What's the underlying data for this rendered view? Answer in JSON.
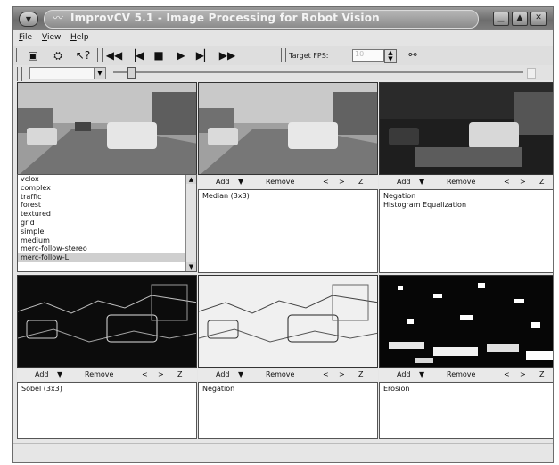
{
  "window": {
    "title": "ImprovCV 5.1 - Image Processing for Robot Vision",
    "sysmenu_icon": "chevron-down-icon",
    "app_icon": "wave-icon",
    "controls": [
      "minimize-icon",
      "maximize-icon",
      "close-icon"
    ]
  },
  "menubar": {
    "items": [
      {
        "label": "File",
        "accel": "F",
        "rest": "ile"
      },
      {
        "label": "View",
        "accel": "V",
        "rest": "iew"
      },
      {
        "label": "Help",
        "accel": "H",
        "rest": "elp"
      }
    ]
  },
  "toolbar": {
    "icons": [
      "camera-icon",
      "settings-icon",
      "help-pointer-icon",
      "skip-back-icon",
      "step-back-icon",
      "stop-icon",
      "play-icon",
      "step-forward-icon",
      "fast-forward-icon"
    ],
    "fps_label": "Target FPS:",
    "fps_value": "10",
    "link_icon": "link-icon"
  },
  "source_list": {
    "items": [
      "vclox",
      "complex",
      "traffic",
      "forest",
      "textured",
      "grid",
      "simple",
      "medium",
      "merc-follow-stereo",
      "merc-follow-L"
    ],
    "selected": "merc-follow-L"
  },
  "controls_row": {
    "add": "Add",
    "dropdown_icon": "triangle-down-icon",
    "remove": "Remove",
    "prev": "<",
    "next": ">",
    "zoom": "Z"
  },
  "panels": [
    {
      "id": "p2",
      "filters": [
        "Median (3x3)"
      ]
    },
    {
      "id": "p3",
      "filters": [
        "Negation",
        "Histogram Equalization"
      ]
    },
    {
      "id": "p4",
      "filters": [
        "Sobel (3x3)"
      ]
    },
    {
      "id": "p5",
      "filters": [
        "Negation"
      ]
    },
    {
      "id": "p6",
      "filters": [
        "Erosion"
      ]
    }
  ]
}
